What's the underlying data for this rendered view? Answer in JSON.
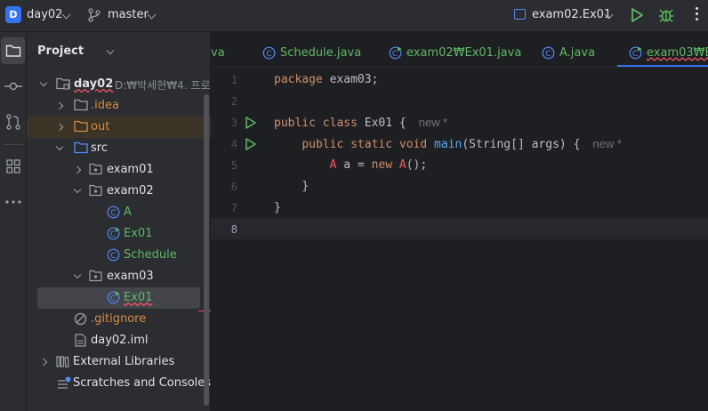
{
  "titlebar": {
    "project_badge": "D",
    "project_name": "day02",
    "branch": "master",
    "run_config": "exam02.Ex01"
  },
  "project_panel": {
    "title": "Project",
    "tree": {
      "root_name": "day02",
      "root_path": "D:₩박세현₩4. 프로",
      "idea": ".idea",
      "out": "out",
      "src": "src",
      "exam01": "exam01",
      "exam02": "exam02",
      "exam02_A": "A",
      "exam02_Ex01": "Ex01",
      "exam02_Schedule": "Schedule",
      "exam03": "exam03",
      "exam03_Ex01": "Ex01",
      "gitignore": ".gitignore",
      "iml": "day02.iml",
      "external_libraries": "External Libraries",
      "scratches": "Scratches and Consoles"
    }
  },
  "tabs": [
    {
      "label": "va"
    },
    {
      "label": "Schedule.java"
    },
    {
      "label": "exam02₩Ex01.java"
    },
    {
      "label": "A.java"
    },
    {
      "label": "exam03₩Ex"
    }
  ],
  "editor": {
    "line_numbers": [
      "1",
      "2",
      "3",
      "4",
      "5",
      "6",
      "7",
      "8"
    ],
    "code": {
      "l1_kw": "package",
      "l1_rest": " exam03;",
      "l3_kw": "public class",
      "l3_rest": " Ex01 {",
      "l3_hint": "new *",
      "l4_kw": "public static void",
      "l4_fn": "main",
      "l4_rest": "(String[] args) {",
      "l4_hint": "new *",
      "l5_cls": "A",
      "l5_mid": " a = ",
      "l5_kw": "new",
      "l5_cls2": " A",
      "l5_rest": "();",
      "l6": "}",
      "l7": "}"
    }
  },
  "colors": {
    "accent": "#3574f0",
    "keyword": "#cf8e6d",
    "function": "#56a8f5",
    "error_red": "#f75464",
    "vcs_green": "#5fb865",
    "vcs_orange": "#d88b44"
  }
}
